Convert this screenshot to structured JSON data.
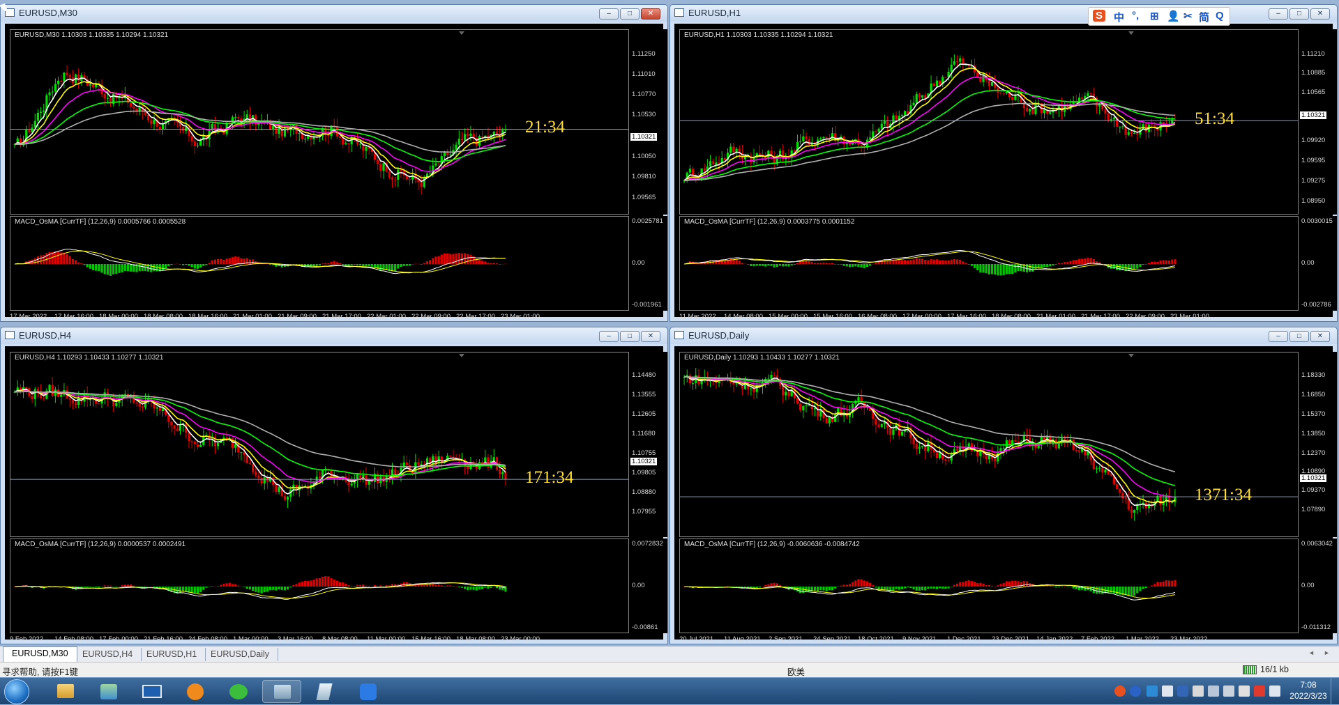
{
  "windows": [
    {
      "title": "EURUSD,M30",
      "info": "EURUSD,M30  1.10303 1.10335 1.10294 1.10321",
      "timer": "21:34",
      "price_labels": [
        "1.11250",
        "1.11010",
        "1.10770",
        "1.10530",
        "1.10321",
        "1.10050",
        "1.09810",
        "1.09565"
      ],
      "current_price_label": "1.10321",
      "macd_info": "MACD_OsMA [CurrTF] (12,26,9) 0.0005766 0.0005528",
      "macd_labels": [
        "0.0025781",
        "0.00",
        "-0.001961"
      ],
      "time_labels": [
        "17 Mar 2022",
        "17 Mar 16:00",
        "18 Mar 00:00",
        "18 Mar 08:00",
        "18 Mar 16:00",
        "21 Mar 01:00",
        "21 Mar 09:00",
        "21 Mar 17:00",
        "22 Mar 01:00",
        "22 Mar 09:00",
        "22 Mar 17:00",
        "23 Mar 01:00"
      ],
      "buttons": {
        "minimize": "–",
        "maximize": "□",
        "close": "✕"
      }
    },
    {
      "title": "EURUSD,H1",
      "info": "EURUSD,H1  1.10303 1.10335 1.10294 1.10321",
      "timer": "51:34",
      "price_labels": [
        "1.11210",
        "1.10885",
        "1.10565",
        "1.10321",
        "1.09920",
        "1.09595",
        "1.09275",
        "1.08950"
      ],
      "current_price_label": "1.10321",
      "macd_info": "MACD_OsMA [CurrTF] (12,26,9) 0.0003775 0.0001152",
      "macd_labels": [
        "0.0030015",
        "0.00",
        "-0.002786"
      ],
      "time_labels": [
        "11 Mar 2022",
        "14 Mar 08:00",
        "15 Mar 00:00",
        "15 Mar 16:00",
        "16 Mar 08:00",
        "17 Mar 00:00",
        "17 Mar 16:00",
        "18 Mar 08:00",
        "21 Mar 01:00",
        "21 Mar 17:00",
        "22 Mar 09:00",
        "23 Mar 01:00"
      ],
      "buttons": {
        "minimize": "–",
        "maximize": "□",
        "close": "✕"
      }
    },
    {
      "title": "EURUSD,H4",
      "info": "EURUSD,H4  1.10293 1.10433 1.10277 1.10321",
      "timer": "171:34",
      "price_labels": [
        "1.14480",
        "1.13555",
        "1.12605",
        "1.11680",
        "1.10755",
        "1.10321",
        "1.09805",
        "1.08880",
        "1.07955"
      ],
      "current_price_label": "1.10321",
      "macd_info": "MACD_OsMA [CurrTF] (12,26,9) 0.0000537 0.0002491",
      "macd_labels": [
        "0.0072832",
        "0.00",
        "-0.00861"
      ],
      "time_labels": [
        "9 Feb 2022",
        "14 Feb 08:00",
        "17 Feb 00:00",
        "21 Feb 16:00",
        "24 Feb 08:00",
        "1 Mar 00:00",
        "3 Mar 16:00",
        "8 Mar 08:00",
        "11 Mar 00:00",
        "15 Mar 16:00",
        "18 Mar 08:00",
        "23 Mar 00:00"
      ],
      "buttons": {
        "minimize": "–",
        "maximize": "□",
        "close": "✕"
      }
    },
    {
      "title": "EURUSD,Daily",
      "info": "EURUSD,Daily  1.10293 1.10433 1.10277 1.10321",
      "timer": "1371:34",
      "price_labels": [
        "1.18330",
        "1.16850",
        "1.15370",
        "1.13850",
        "1.12370",
        "1.10890",
        "1.10321",
        "1.09370",
        "1.07890"
      ],
      "current_price_label": "1.10321",
      "macd_info": "MACD_OsMA [CurrTF] (12,26,9) -0.0060636 -0.0084742",
      "macd_labels": [
        "0.0063042",
        "0.00",
        "-0.011312"
      ],
      "time_labels": [
        "20 Jul 2021",
        "11 Aug 2021",
        "2 Sep 2021",
        "24 Sep 2021",
        "18 Oct 2021",
        "9 Nov 2021",
        "1 Dec 2021",
        "23 Dec 2021",
        "14 Jan 2022",
        "7 Feb 2022",
        "1 Mar 2022",
        "23 Mar 2022"
      ],
      "buttons": {
        "minimize": "–",
        "maximize": "□",
        "close": "✕"
      }
    }
  ],
  "tabs": [
    "EURUSD,M30",
    "EURUSD,H4",
    "EURUSD,H1",
    "EURUSD,Daily"
  ],
  "tab_scroll": {
    "left": "◄",
    "right": "►"
  },
  "status": {
    "help": "寻求帮助, 请按F1键",
    "profile": "欧美",
    "traffic": "16/1 kb"
  },
  "ime_toolbar": {
    "items": [
      "S",
      "中",
      "°,",
      "⊞",
      "👤",
      "✂",
      "简",
      "Q"
    ]
  },
  "clock": {
    "time": "7:08",
    "date": "2022/3/23"
  },
  "colors": {
    "bull": "#00e000",
    "bear": "#e00000",
    "ma_white": "#ffffff",
    "ma_yellow": "#ffff00",
    "ma_magenta": "#ff00ff",
    "ma_green": "#00ff00",
    "ma_gray": "#b0b0b0",
    "timer": "#ffe033"
  }
}
